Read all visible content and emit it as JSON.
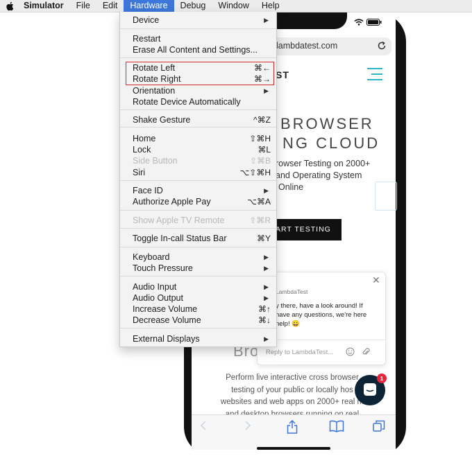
{
  "menubar": {
    "app": "Simulator",
    "items": [
      "File",
      "Edit",
      "Hardware",
      "Debug",
      "Window",
      "Help"
    ]
  },
  "device_screen": {
    "url": "lambdatest.com",
    "logo_fragment": "ST",
    "hero_line1": "BROWSER",
    "hero_line2": "NG CLOUD",
    "hero_sub": [
      "rowser Testing on 2000+",
      "and Operating System",
      "Online"
    ],
    "cta": "ART TESTING",
    "chat_from": "LambdaTest",
    "chat_lines": [
      "y there, have a look around! If",
      "have any questions, we're here",
      "help! 😀"
    ],
    "chat_reply_placeholder": "Reply to LambdaTest...",
    "faded_heading": "Bro",
    "paragraph": [
      "Perform live interactive cross browser",
      "testing of your public or locally hos",
      "websites and web apps on 2000+ real m",
      "and desktop browsers running on real"
    ],
    "badge": "1"
  },
  "hardware_menu": {
    "items": [
      {
        "label": "Device",
        "shortcut": "",
        "submenu": true,
        "disabled": false
      },
      {
        "label": "Restart",
        "shortcut": "",
        "submenu": false,
        "disabled": false
      },
      {
        "label": "Erase All Content and Settings...",
        "shortcut": "",
        "submenu": false,
        "disabled": false
      },
      {
        "label": "Rotate Left",
        "shortcut": "⌘←",
        "submenu": false,
        "disabled": false
      },
      {
        "label": "Rotate Right",
        "shortcut": "⌘→",
        "submenu": false,
        "disabled": false
      },
      {
        "label": "Orientation",
        "shortcut": "",
        "submenu": true,
        "disabled": false
      },
      {
        "label": "Rotate Device Automatically",
        "shortcut": "",
        "submenu": false,
        "disabled": false
      },
      {
        "label": "Shake Gesture",
        "shortcut": "^⌘Z",
        "submenu": false,
        "disabled": false
      },
      {
        "label": "Home",
        "shortcut": "⇧⌘H",
        "submenu": false,
        "disabled": false
      },
      {
        "label": "Lock",
        "shortcut": "⌘L",
        "submenu": false,
        "disabled": false
      },
      {
        "label": "Side Button",
        "shortcut": "⇧⌘B",
        "submenu": false,
        "disabled": true
      },
      {
        "label": "Siri",
        "shortcut": "⌥⇧⌘H",
        "submenu": false,
        "disabled": false
      },
      {
        "label": "Face ID",
        "shortcut": "",
        "submenu": true,
        "disabled": false
      },
      {
        "label": "Authorize Apple Pay",
        "shortcut": "⌥⌘A",
        "submenu": false,
        "disabled": false
      },
      {
        "label": "Show Apple TV Remote",
        "shortcut": "⇧⌘R",
        "submenu": false,
        "disabled": true
      },
      {
        "label": "Toggle In-call Status Bar",
        "shortcut": "⌘Y",
        "submenu": false,
        "disabled": false
      },
      {
        "label": "Keyboard",
        "shortcut": "",
        "submenu": true,
        "disabled": false
      },
      {
        "label": "Touch Pressure",
        "shortcut": "",
        "submenu": true,
        "disabled": false
      },
      {
        "label": "Audio Input",
        "shortcut": "",
        "submenu": true,
        "disabled": false
      },
      {
        "label": "Audio Output",
        "shortcut": "",
        "submenu": true,
        "disabled": false
      },
      {
        "label": "Increase Volume",
        "shortcut": "⌘↑",
        "submenu": false,
        "disabled": false
      },
      {
        "label": "Decrease Volume",
        "shortcut": "⌘↓",
        "submenu": false,
        "disabled": false
      },
      {
        "label": "External Displays",
        "shortcut": "",
        "submenu": true,
        "disabled": false
      }
    ]
  },
  "colors": {
    "menu_highlight": "#3c77d9",
    "annotation_box": "#d22a2a",
    "accent_teal": "#28b5c4",
    "notification": "#e5253a"
  }
}
